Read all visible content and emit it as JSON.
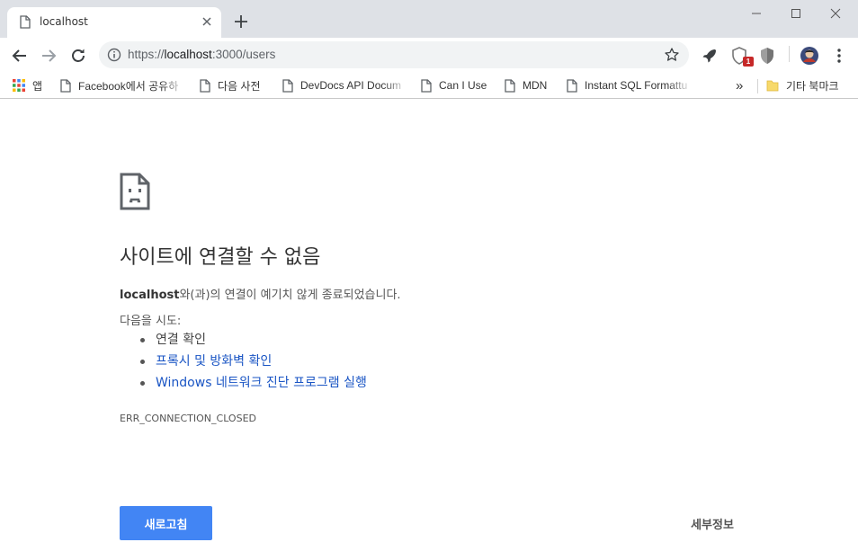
{
  "tab": {
    "title": "localhost"
  },
  "omnibox": {
    "url_scheme": "https://",
    "url_host": "localhost",
    "url_rest": ":3000/users"
  },
  "toolbar": {
    "extension_badge": "1"
  },
  "bookmarks": {
    "apps_label": "앱",
    "items": [
      {
        "label": "Facebook에서 공유하"
      },
      {
        "label": "다음 사전"
      },
      {
        "label": "DevDocs API Docum"
      },
      {
        "label": "Can I Use"
      },
      {
        "label": "MDN"
      },
      {
        "label": "Instant SQL Formattu"
      }
    ],
    "overflow": "»",
    "other_bookmarks": "기타 북마크"
  },
  "error": {
    "title": "사이트에 연결할 수 없음",
    "host": "localhost",
    "message_suffix": "와(과)의 연결이 예기치 않게 종료되었습니다.",
    "try_label": "다음을 시도:",
    "suggestions": [
      {
        "text": "연결 확인",
        "link": false
      },
      {
        "text": "프록시 및 방화벽 확인",
        "link": true
      },
      {
        "text": "Windows 네트워크 진단 프로그램 실행",
        "link": true
      }
    ],
    "code": "ERR_CONNECTION_CLOSED",
    "reload_label": "새로고침",
    "details_label": "세부정보"
  },
  "colors": {
    "accent": "#4285f4",
    "link": "#1a55c4",
    "tabstrip": "#dee1e6",
    "omnibox": "#f1f3f4"
  }
}
